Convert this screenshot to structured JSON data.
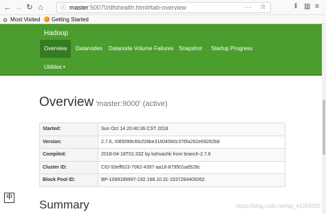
{
  "browser": {
    "url_host": "master",
    "url_rest": ":50070/dfshealth.html#tab-overview",
    "page_actions": "···",
    "icons": [
      "back-arrow-icon",
      "forward-arrow-icon",
      "reload-icon",
      "home-icon",
      "info-icon",
      "star-icon",
      "library-icon",
      "sidebar-icon",
      "menu-icon"
    ]
  },
  "bookmarks": [
    {
      "label": "Most Visited",
      "icon": "gear-icon"
    },
    {
      "label": "Getting Started",
      "icon": "firefox-icon"
    }
  ],
  "navbar": {
    "brand": "Hadoop",
    "items": [
      "Overview",
      "Datanodes",
      "Datanode Volume Failures",
      "Snapshot",
      "Startup Progress"
    ],
    "active_index": 0,
    "utilities": "Utilities",
    "colors": {
      "background": "#4b9e2e",
      "active": "#357b1f"
    }
  },
  "overview": {
    "title": "Overview",
    "subtitle": "'master:9000' (active)",
    "rows": [
      {
        "key": "Started:",
        "value": "Sun Oct 14 20:40:36 CST 2018"
      },
      {
        "key": "Version:",
        "value": "2.7.6, r085099c66cf28be31604560c376fa282e69282b8"
      },
      {
        "key": "Compiled:",
        "value": "2018-04-18T01:33Z by kshvachk from branch-2.7.6"
      },
      {
        "key": "Cluster ID:",
        "value": "CID-93eff623-7062-4397-aa18-879501ad528c"
      },
      {
        "key": "Block Pool ID:",
        "value": "BP-1089189997-192.168.10.31-1537264409262"
      }
    ]
  },
  "summary": {
    "title": "Summary"
  },
  "ime_indicator": "中",
  "watermark": "https://blog.csdn.net/qq_41059320"
}
